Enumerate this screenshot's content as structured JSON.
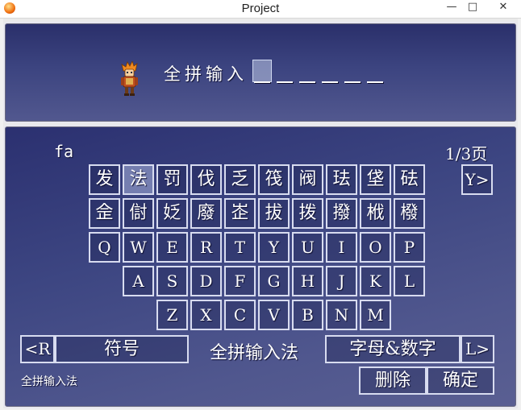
{
  "window": {
    "title": "Project",
    "minimize": "—",
    "maximize": "□",
    "close": "✕"
  },
  "input": {
    "mode_label": "全拼输入"
  },
  "keyboard": {
    "pinyin": "fa",
    "page": "1/3页",
    "candidates_row1": [
      "发",
      "法",
      "罚",
      "伐",
      "乏",
      "筏",
      "阀",
      "珐",
      "垡",
      "砝"
    ],
    "candidates_row2": [
      "佱",
      "傠",
      "姂",
      "廢",
      "峜",
      "拔",
      "拨",
      "撥",
      "栰",
      "橃"
    ],
    "next_page_key": "Y>",
    "letters_row1": [
      "Q",
      "W",
      "E",
      "R",
      "T",
      "Y",
      "U",
      "I",
      "O",
      "P"
    ],
    "letters_row2": [
      "A",
      "S",
      "D",
      "F",
      "G",
      "H",
      "J",
      "K",
      "L"
    ],
    "letters_row3": [
      "Z",
      "X",
      "C",
      "V",
      "B",
      "N",
      "M"
    ],
    "prev_mode_key": "<R",
    "symbols_key": "符号",
    "current_mode": "全拼输入法",
    "alnum_key": "字母&数字",
    "next_mode_key": "L>",
    "status": "全拼输入法",
    "delete_key": "删除",
    "confirm_key": "确定"
  }
}
